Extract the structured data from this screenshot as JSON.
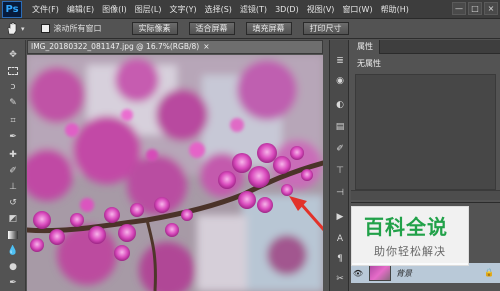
{
  "app": {
    "logo": "Ps"
  },
  "menu": [
    "文件(F)",
    "编辑(E)",
    "图像(I)",
    "图层(L)",
    "文字(Y)",
    "选择(S)",
    "滤镜(T)",
    "3D(D)",
    "视图(V)",
    "窗口(W)",
    "帮助(H)"
  ],
  "window_controls": [
    "—",
    "□",
    "×"
  ],
  "options": {
    "checkbox_label": "滚动所有窗口",
    "buttons": [
      "实际像素",
      "适合屏幕",
      "填充屏幕",
      "打印尺寸"
    ]
  },
  "document": {
    "tab_title": "IMG_20180322_081147.jpg @ 16.7%(RGB/8)",
    "close": "×"
  },
  "properties": {
    "tab": "属性",
    "title": "无属性"
  },
  "layers": {
    "layer_name": "背景"
  },
  "watermark": {
    "title": "百科全说",
    "subtitle": "助你轻松解决"
  },
  "icons": {
    "tools": [
      "hand-icon",
      "move-icon",
      "marquee-icon",
      "lasso-icon",
      "quick-select-icon",
      "crop-icon",
      "eyedropper-icon",
      "healing-icon",
      "brush-icon",
      "stamp-icon",
      "history-brush-icon",
      "eraser-icon",
      "gradient-icon",
      "blur-icon",
      "dodge-icon",
      "pen-icon"
    ]
  }
}
